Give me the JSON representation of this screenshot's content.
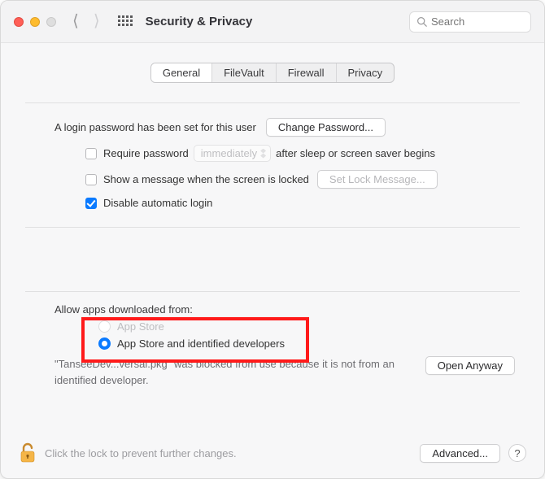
{
  "window": {
    "title": "Security & Privacy"
  },
  "search": {
    "placeholder": "Search"
  },
  "tabs": {
    "general": "General",
    "filevault": "FileVault",
    "firewall": "Firewall",
    "privacy": "Privacy"
  },
  "login": {
    "password_set_text": "A login password has been set for this user",
    "change_password_btn": "Change Password...",
    "require_password_label": "Require password",
    "require_password_delay": "immediately",
    "require_password_suffix": "after sleep or screen saver begins",
    "show_message_label": "Show a message when the screen is locked",
    "set_lock_message_btn": "Set Lock Message...",
    "disable_auto_login_label": "Disable automatic login"
  },
  "gatekeeper": {
    "allow_label": "Allow apps downloaded from:",
    "option_app_store": "App Store",
    "option_identified": "App Store and identified developers",
    "blocked_text": "\"TanseeDev...versal.pkg\" was blocked from use because it is not from an identified developer.",
    "open_anyway_btn": "Open Anyway"
  },
  "footer": {
    "lock_text": "Click the lock to prevent further changes.",
    "advanced_btn": "Advanced...",
    "help": "?"
  }
}
